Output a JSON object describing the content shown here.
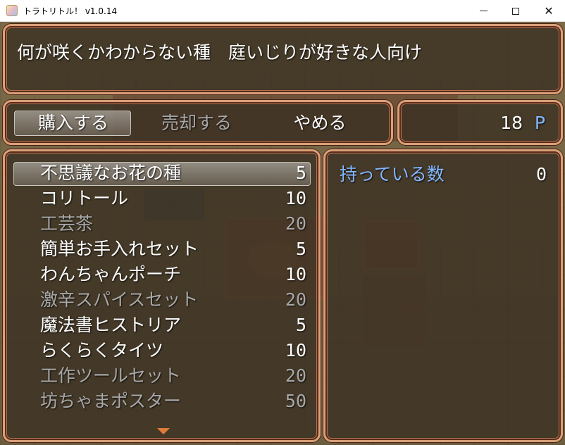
{
  "window": {
    "title": "トラトリトル！ v1.0.14",
    "minimize_glyph": "",
    "maximize_glyph": "",
    "close_glyph": "✕"
  },
  "help": {
    "text": "何が咲くかわからない種　庭いじりが好きな人向け"
  },
  "commands": [
    {
      "label": "購入する",
      "enabled": true,
      "selected": true
    },
    {
      "label": "売却する",
      "enabled": false,
      "selected": false
    },
    {
      "label": "やめる",
      "enabled": true,
      "selected": false
    }
  ],
  "gold": {
    "value": "18",
    "unit": "P"
  },
  "items": [
    {
      "name": "不思議なお花の種",
      "price": "5",
      "enabled": true,
      "selected": true
    },
    {
      "name": "コリトール",
      "price": "10",
      "enabled": true,
      "selected": false
    },
    {
      "name": "工芸茶",
      "price": "20",
      "enabled": false,
      "selected": false
    },
    {
      "name": "簡単お手入れセット",
      "price": "5",
      "enabled": true,
      "selected": false
    },
    {
      "name": "わんちゃんポーチ",
      "price": "10",
      "enabled": true,
      "selected": false
    },
    {
      "name": "激辛スパイスセット",
      "price": "20",
      "enabled": false,
      "selected": false
    },
    {
      "name": "魔法書ヒストリア",
      "price": "5",
      "enabled": true,
      "selected": false
    },
    {
      "name": "らくらくタイツ",
      "price": "10",
      "enabled": true,
      "selected": false
    },
    {
      "name": "工作ツールセット",
      "price": "20",
      "enabled": false,
      "selected": false
    },
    {
      "name": "坊ちゃまポスター",
      "price": "50",
      "enabled": false,
      "selected": false
    }
  ],
  "status": {
    "possession_label": "持っている数",
    "possession_value": "0"
  },
  "colors": {
    "system_blue": "#84b7ff",
    "disabled": "#a8a8a8",
    "frame": "#d9a079",
    "scroll_arrow": "#e07a3a"
  }
}
